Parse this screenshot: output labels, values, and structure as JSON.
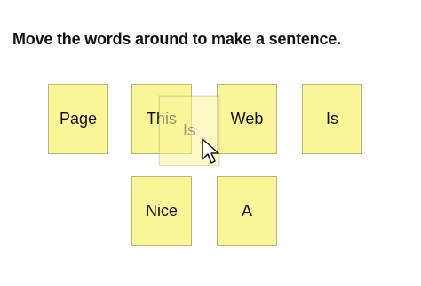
{
  "instruction": "Move the words around to make a sentence.",
  "tiles": [
    {
      "word": "Page"
    },
    {
      "word": "This"
    },
    {
      "word": "Web"
    },
    {
      "word": "Is"
    },
    {
      "word": "Nice"
    },
    {
      "word": "A"
    }
  ],
  "dragging_tile": {
    "word": "Is"
  },
  "colors": {
    "tile_fill": "#fbf59a",
    "tile_border": "#b9b47a"
  },
  "icons": {
    "cursor": "arrow-cursor-icon"
  }
}
